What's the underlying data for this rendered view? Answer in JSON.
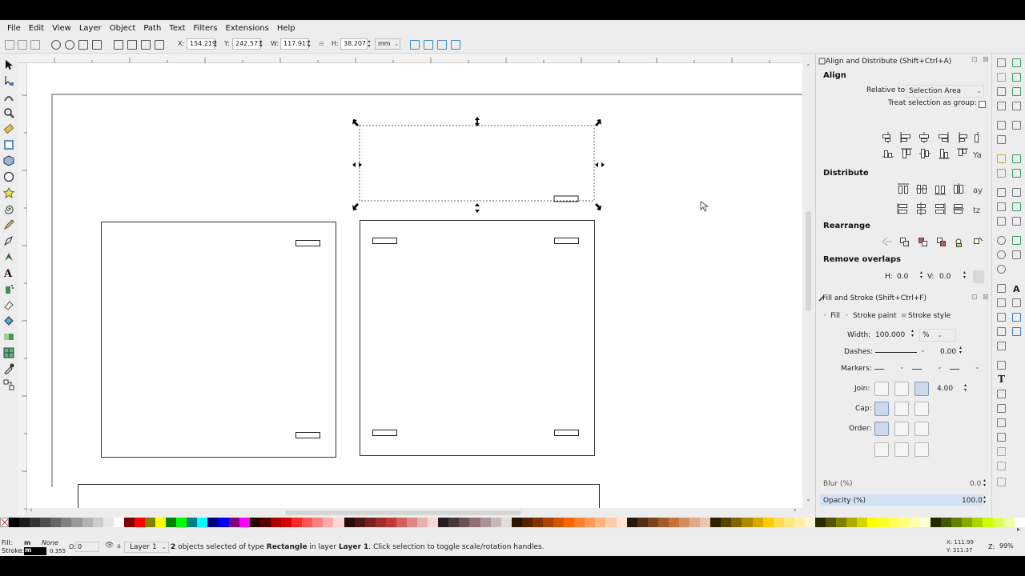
{
  "menubar": {
    "items": [
      "File",
      "Edit",
      "View",
      "Layer",
      "Object",
      "Path",
      "Text",
      "Filters",
      "Extensions",
      "Help"
    ]
  },
  "toolbar": {
    "x_label": "X:",
    "x_value": "154.219",
    "y_label": "Y:",
    "y_value": "242.573",
    "w_label": "W:",
    "w_value": "117.917",
    "h_label": "H:",
    "h_value": "38.207",
    "unit": "mm"
  },
  "align_panel": {
    "title": "Align and Distribute (Shift+Ctrl+A)",
    "align_heading": "Align",
    "relative_to_label": "Relative to:",
    "relative_to_value": "Selection Area",
    "treat_group_label": "Treat selection as group:",
    "distribute_heading": "Distribute",
    "rearrange_heading": "Rearrange",
    "remove_overlaps_heading": "Remove overlaps",
    "h_label": "H:",
    "h_value": "0.0",
    "v_label": "V:",
    "v_value": "0.0"
  },
  "fill_stroke_panel": {
    "title": "Fill and Stroke (Shift+Ctrl+F)",
    "tabs": [
      "Fill",
      "Stroke paint",
      "Stroke style"
    ],
    "width_label": "Width:",
    "width_value": "100.000",
    "width_unit": "%",
    "dashes_label": "Dashes:",
    "dashes_value": "0.00",
    "markers_label": "Markers:",
    "join_label": "Join:",
    "miter_value": "4.00",
    "cap_label": "Cap:",
    "order_label": "Order:",
    "blur_label": "Blur (%)",
    "blur_value": "0.0",
    "opacity_label": "Opacity (%)",
    "opacity_value": "100.0"
  },
  "statusbar": {
    "fill_label": "Fill:",
    "fill_value": "m",
    "stroke_label": "Stroke:",
    "stroke_value": "m",
    "none_label": "None",
    "stroke_width": "0.355",
    "opacity_label": "O:",
    "opacity_value": "0",
    "layer_name": "Layer 1",
    "message_count": "2",
    "message_part1": " objects selected of type ",
    "message_type": "Rectangle",
    "message_part2": " in layer ",
    "message_layer": "Layer 1",
    "message_part3": ". Click selection to toggle scale/rotation handles.",
    "cursor_x": "X: 111.99",
    "cursor_y": "Y: 311.37",
    "zoom_label": "Z:",
    "zoom_value": "99%"
  },
  "colors": {
    "selection_handle": "#000000",
    "opacity_bar": "#d3e2f2"
  }
}
